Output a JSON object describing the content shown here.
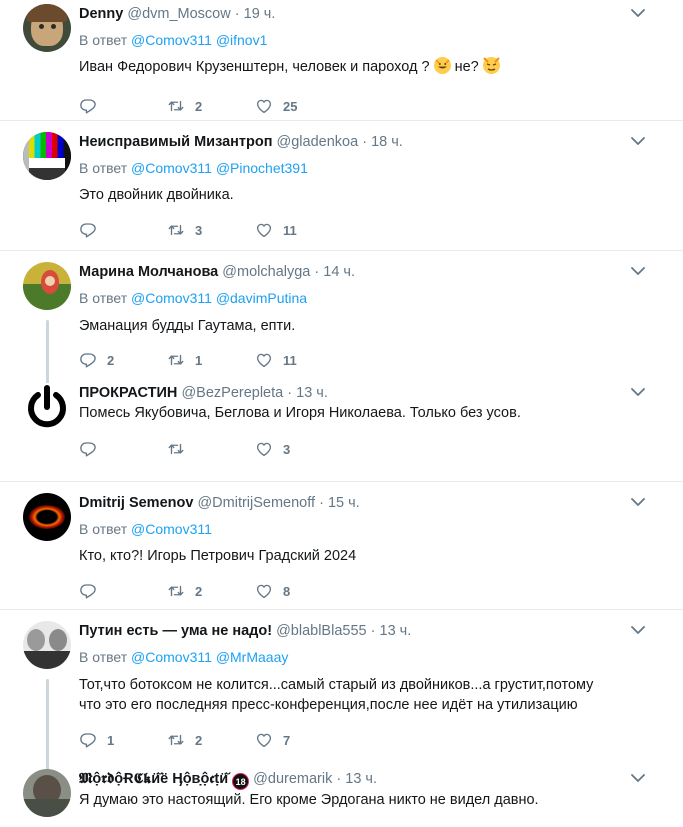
{
  "tweets": [
    {
      "name": "Denny",
      "handle": "@dvm_Moscow",
      "dot": "·",
      "time": "19 ч.",
      "reply_prefix": "В ответ",
      "mentions": [
        "@Comov311",
        "@ifnov1"
      ],
      "text_a": "Иван Федорович Крузенштерн, человек и пароход ?",
      "text_b": "не?",
      "replies": "",
      "retweets": "2",
      "likes": "25"
    },
    {
      "name": "Неисправимый Мизантроп",
      "handle": "@gladenkoa",
      "dot": "·",
      "time": "18 ч.",
      "reply_prefix": "В ответ",
      "mentions": [
        "@Comov311",
        "@Pinochet391"
      ],
      "text": "Это двойник двойника.",
      "replies": "",
      "retweets": "3",
      "likes": "11"
    },
    {
      "name": "Марина Молчанова",
      "handle": "@molchalyga",
      "dot": "·",
      "time": "14 ч.",
      "reply_prefix": "В ответ",
      "mentions": [
        "@Comov311",
        "@davimPutina"
      ],
      "text": "Эманация будды Гаутама, епти.",
      "replies": "2",
      "retweets": "1",
      "likes": "11"
    },
    {
      "name": "ПРОКРАСТИН",
      "handle": "@BezPerepleta",
      "dot": "·",
      "time": "13 ч.",
      "text": "Помесь Якубовича, Беглова и Игоря Николаева. Только без усов.",
      "replies": "",
      "retweets": "",
      "likes": "3"
    },
    {
      "name": "Dmitrij Semenov",
      "handle": "@DmitrijSemenoff",
      "dot": "·",
      "time": "15 ч.",
      "reply_prefix": "В ответ",
      "mentions": [
        "@Comov311"
      ],
      "text": "Кто, кто?! Игорь Петрович Градский 2024",
      "replies": "",
      "retweets": "2",
      "likes": "8"
    },
    {
      "name": "Путин есть — ума не надо!",
      "handle": "@blablBla555",
      "dot": "·",
      "time": "13 ч.",
      "reply_prefix": "В ответ",
      "mentions": [
        "@Comov311",
        "@MrMaaay"
      ],
      "text_l1": "Тот,что ботоксом не колится...самый старый из двойников...а грустит,потому",
      "text_l2": "что это его последняя пресс-конференция,после нее идёт на утилизацию",
      "replies": "1",
      "retweets": "2",
      "likes": "7"
    },
    {
      "name": "𝕸ộ𝖗𝖉ộɌ𝕮𝖐ӥ̆ё Ӊộв̣ộ𝖈ṭӥ̆",
      "badge": "18",
      "handle": "@duremarik",
      "dot": "·",
      "time": "13 ч.",
      "text": "Я думаю это настоящий. Его кроме Эрдогана никто не видел давно."
    }
  ],
  "colors": {
    "link": "#1da1f2",
    "muted": "#657786",
    "border": "#e6ecf0",
    "thread": "#ccd6dd"
  },
  "icons": [
    "reply-icon",
    "retweet-icon",
    "like-icon",
    "caret-down-icon",
    "grinning-cat-emoji",
    "smirking-devil-emoji"
  ]
}
